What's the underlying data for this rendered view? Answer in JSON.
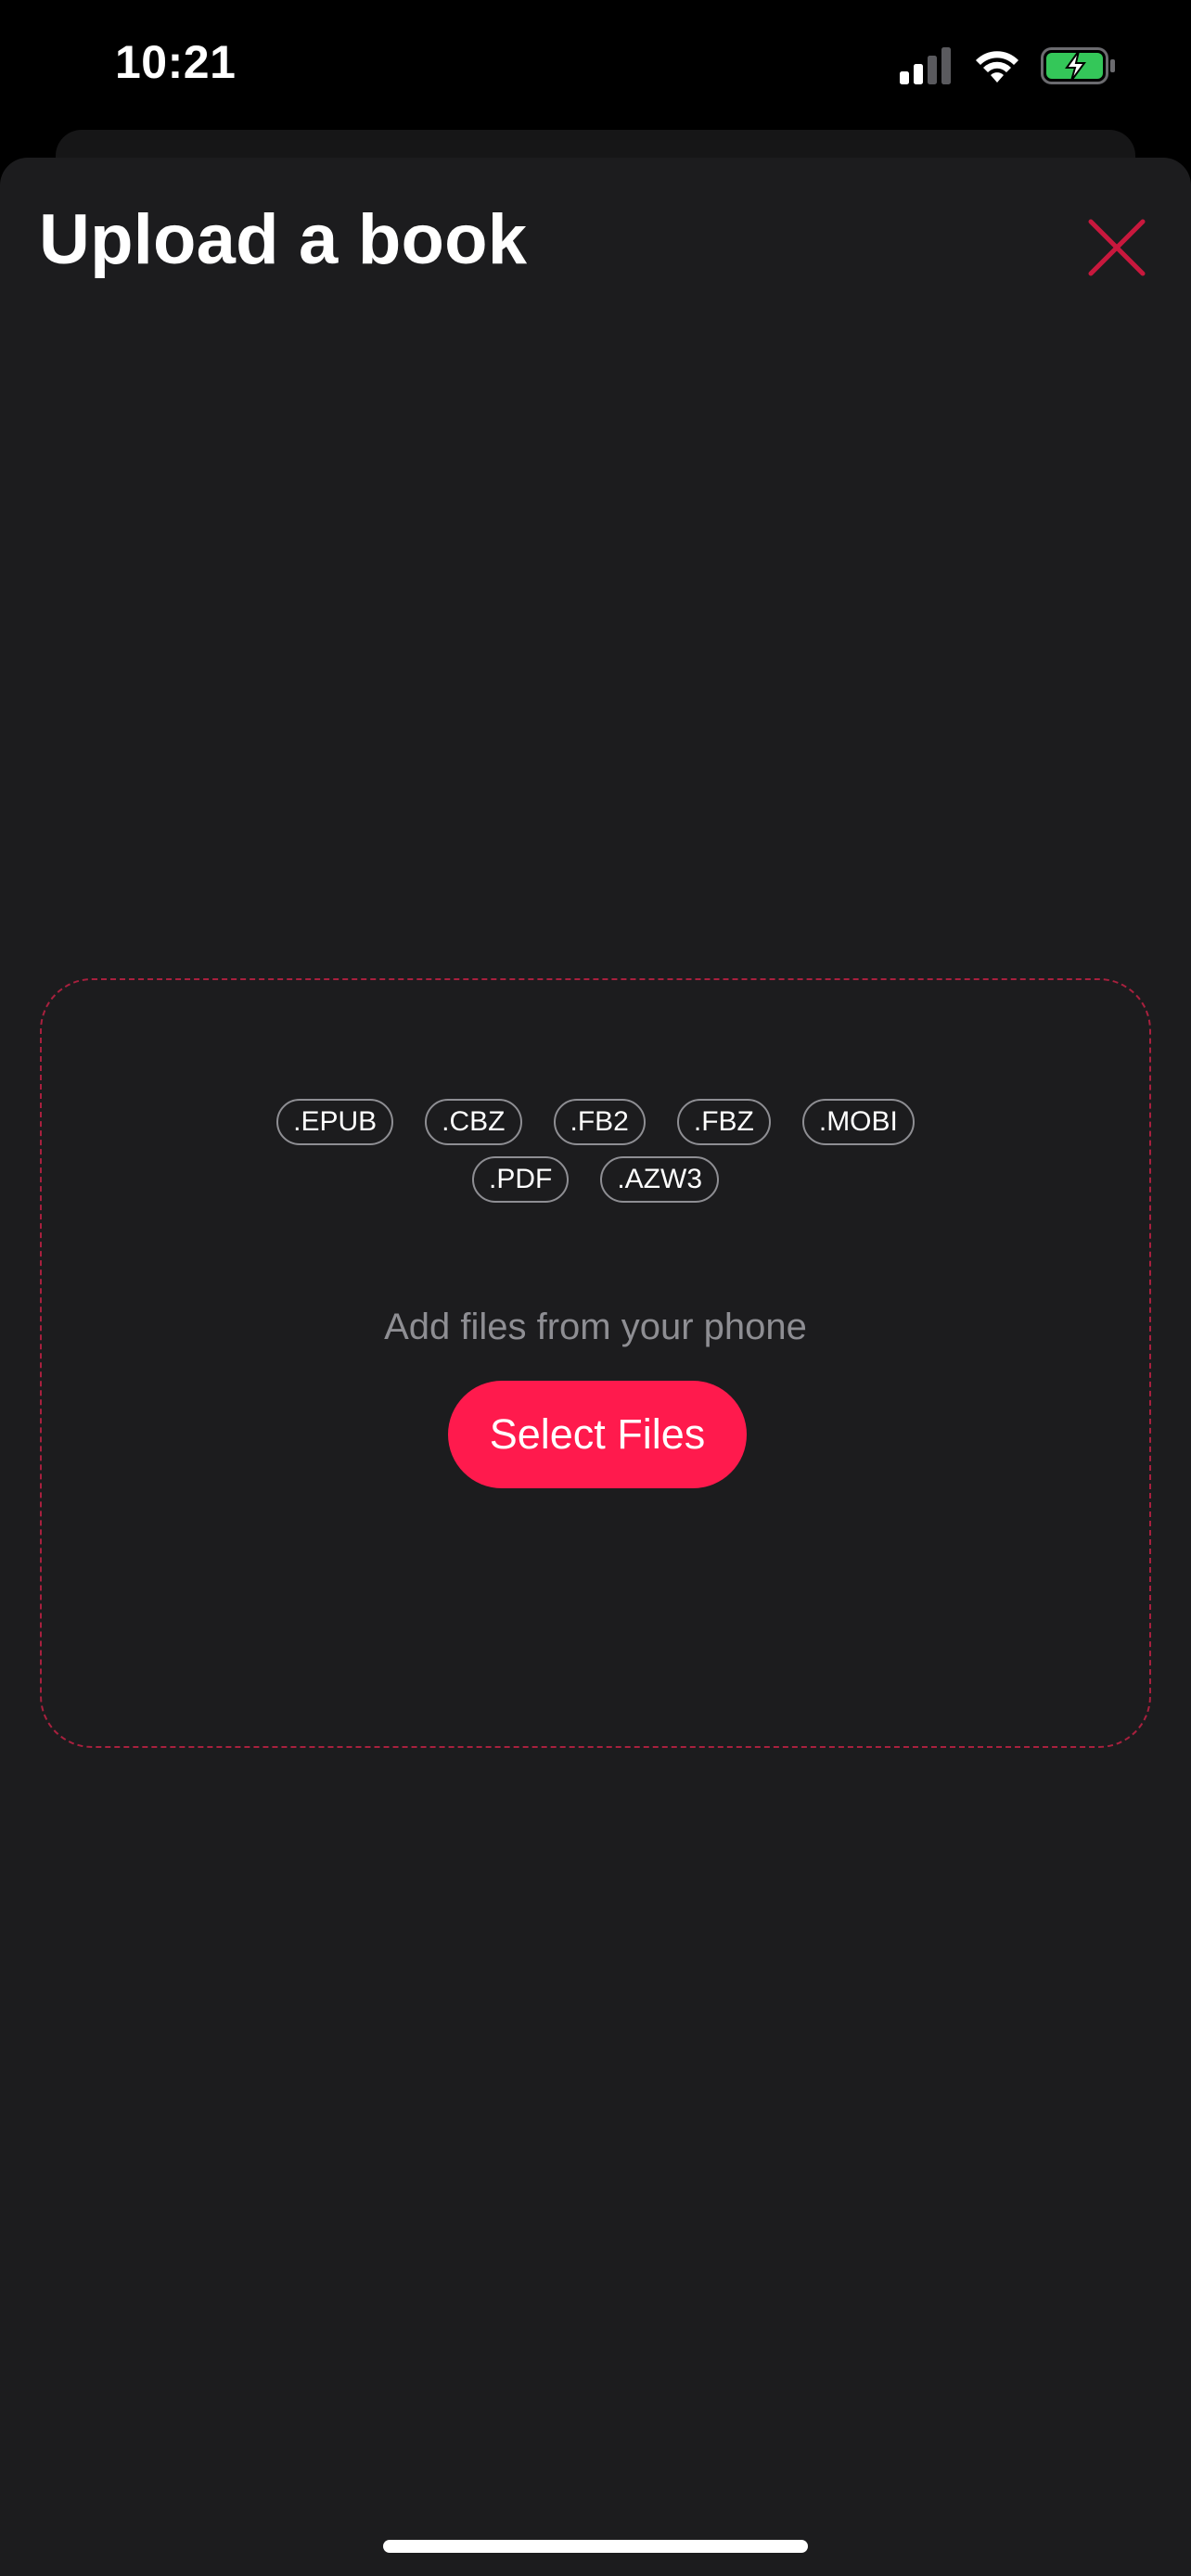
{
  "status_bar": {
    "time": "10:21",
    "icons": [
      "cellular-signal-icon",
      "wifi-icon",
      "battery-charging-icon"
    ]
  },
  "sheet": {
    "title": "Upload a book",
    "close_icon": "close-icon"
  },
  "dropzone": {
    "formats": [
      ".EPUB",
      ".CBZ",
      ".FB2",
      ".FBZ",
      ".MOBI",
      ".PDF",
      ".AZW3"
    ],
    "helper_text": "Add files from your phone",
    "select_label": "Select Files"
  },
  "colors": {
    "accent": "#ff1a4d",
    "close": "#c8183d",
    "dashed_border": "#a8203e",
    "sheet_background": "#1c1c1e",
    "battery_green": "#34c759"
  }
}
